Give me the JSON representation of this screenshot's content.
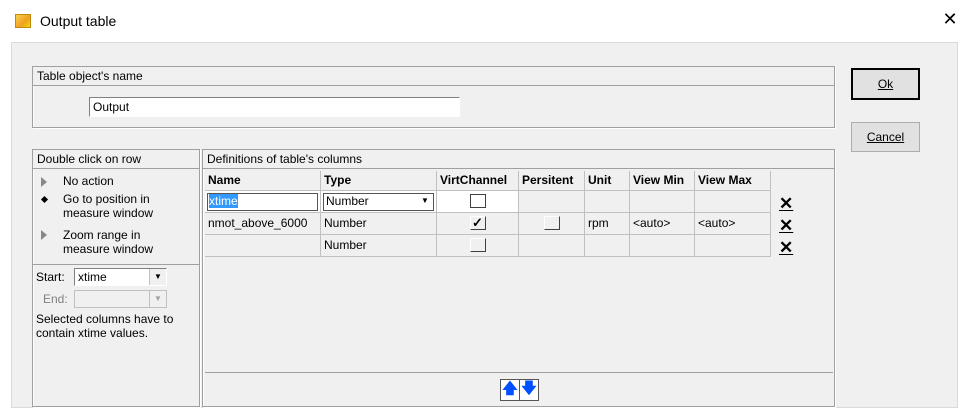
{
  "window": {
    "title": "Output table",
    "close_glyph": "✕"
  },
  "name_group": {
    "caption": "Table object's name",
    "value": "Output"
  },
  "buttons": {
    "ok": "Ok",
    "cancel": "Cancel"
  },
  "dblclick_group": {
    "caption": "Double click on row",
    "options": [
      {
        "label": "No action",
        "selected": false
      },
      {
        "label": "Go to position in measure window",
        "selected": true
      },
      {
        "label": "Zoom range in measure window",
        "selected": false
      }
    ],
    "option_lines": [
      [
        "No action"
      ],
      [
        "Go to position in",
        "measure window"
      ],
      [
        "Zoom range in",
        "measure window"
      ]
    ],
    "start_label": "Start:",
    "start_value": "xtime",
    "end_label": "End:",
    "end_value": "",
    "note_line1": "Selected columns have to",
    "note_line2": "contain xtime values."
  },
  "columns_group": {
    "caption": "Definitions of table's columns",
    "headers": [
      "Name",
      "Type",
      "VirtChannel",
      "Persitent",
      "Unit",
      "View Min",
      "View Max"
    ],
    "rows": [
      {
        "name": "xtime",
        "type": "Number",
        "virt": "unchecked-white",
        "persistent": "",
        "unit": "",
        "view_min": "",
        "view_max": ""
      },
      {
        "name": "nmot_above_6000",
        "type": "Number",
        "virt": "checked",
        "persistent": "unchecked",
        "unit": "rpm",
        "view_min": "<auto>",
        "view_max": "<auto>"
      },
      {
        "name": "",
        "type": "Number",
        "virt": "unchecked",
        "persistent": "",
        "unit": "",
        "view_min": "",
        "view_max": ""
      }
    ],
    "move_up_glyph": "🡅",
    "move_down_glyph": "🡇"
  },
  "colors": {
    "dialog_bg": "#f0f0f0",
    "selection": "#3399ff",
    "arrow_blue": "#0050ff"
  },
  "icons": {
    "title": "app-icon",
    "delete": "delete-row-icon",
    "check": "checkmark-icon"
  }
}
